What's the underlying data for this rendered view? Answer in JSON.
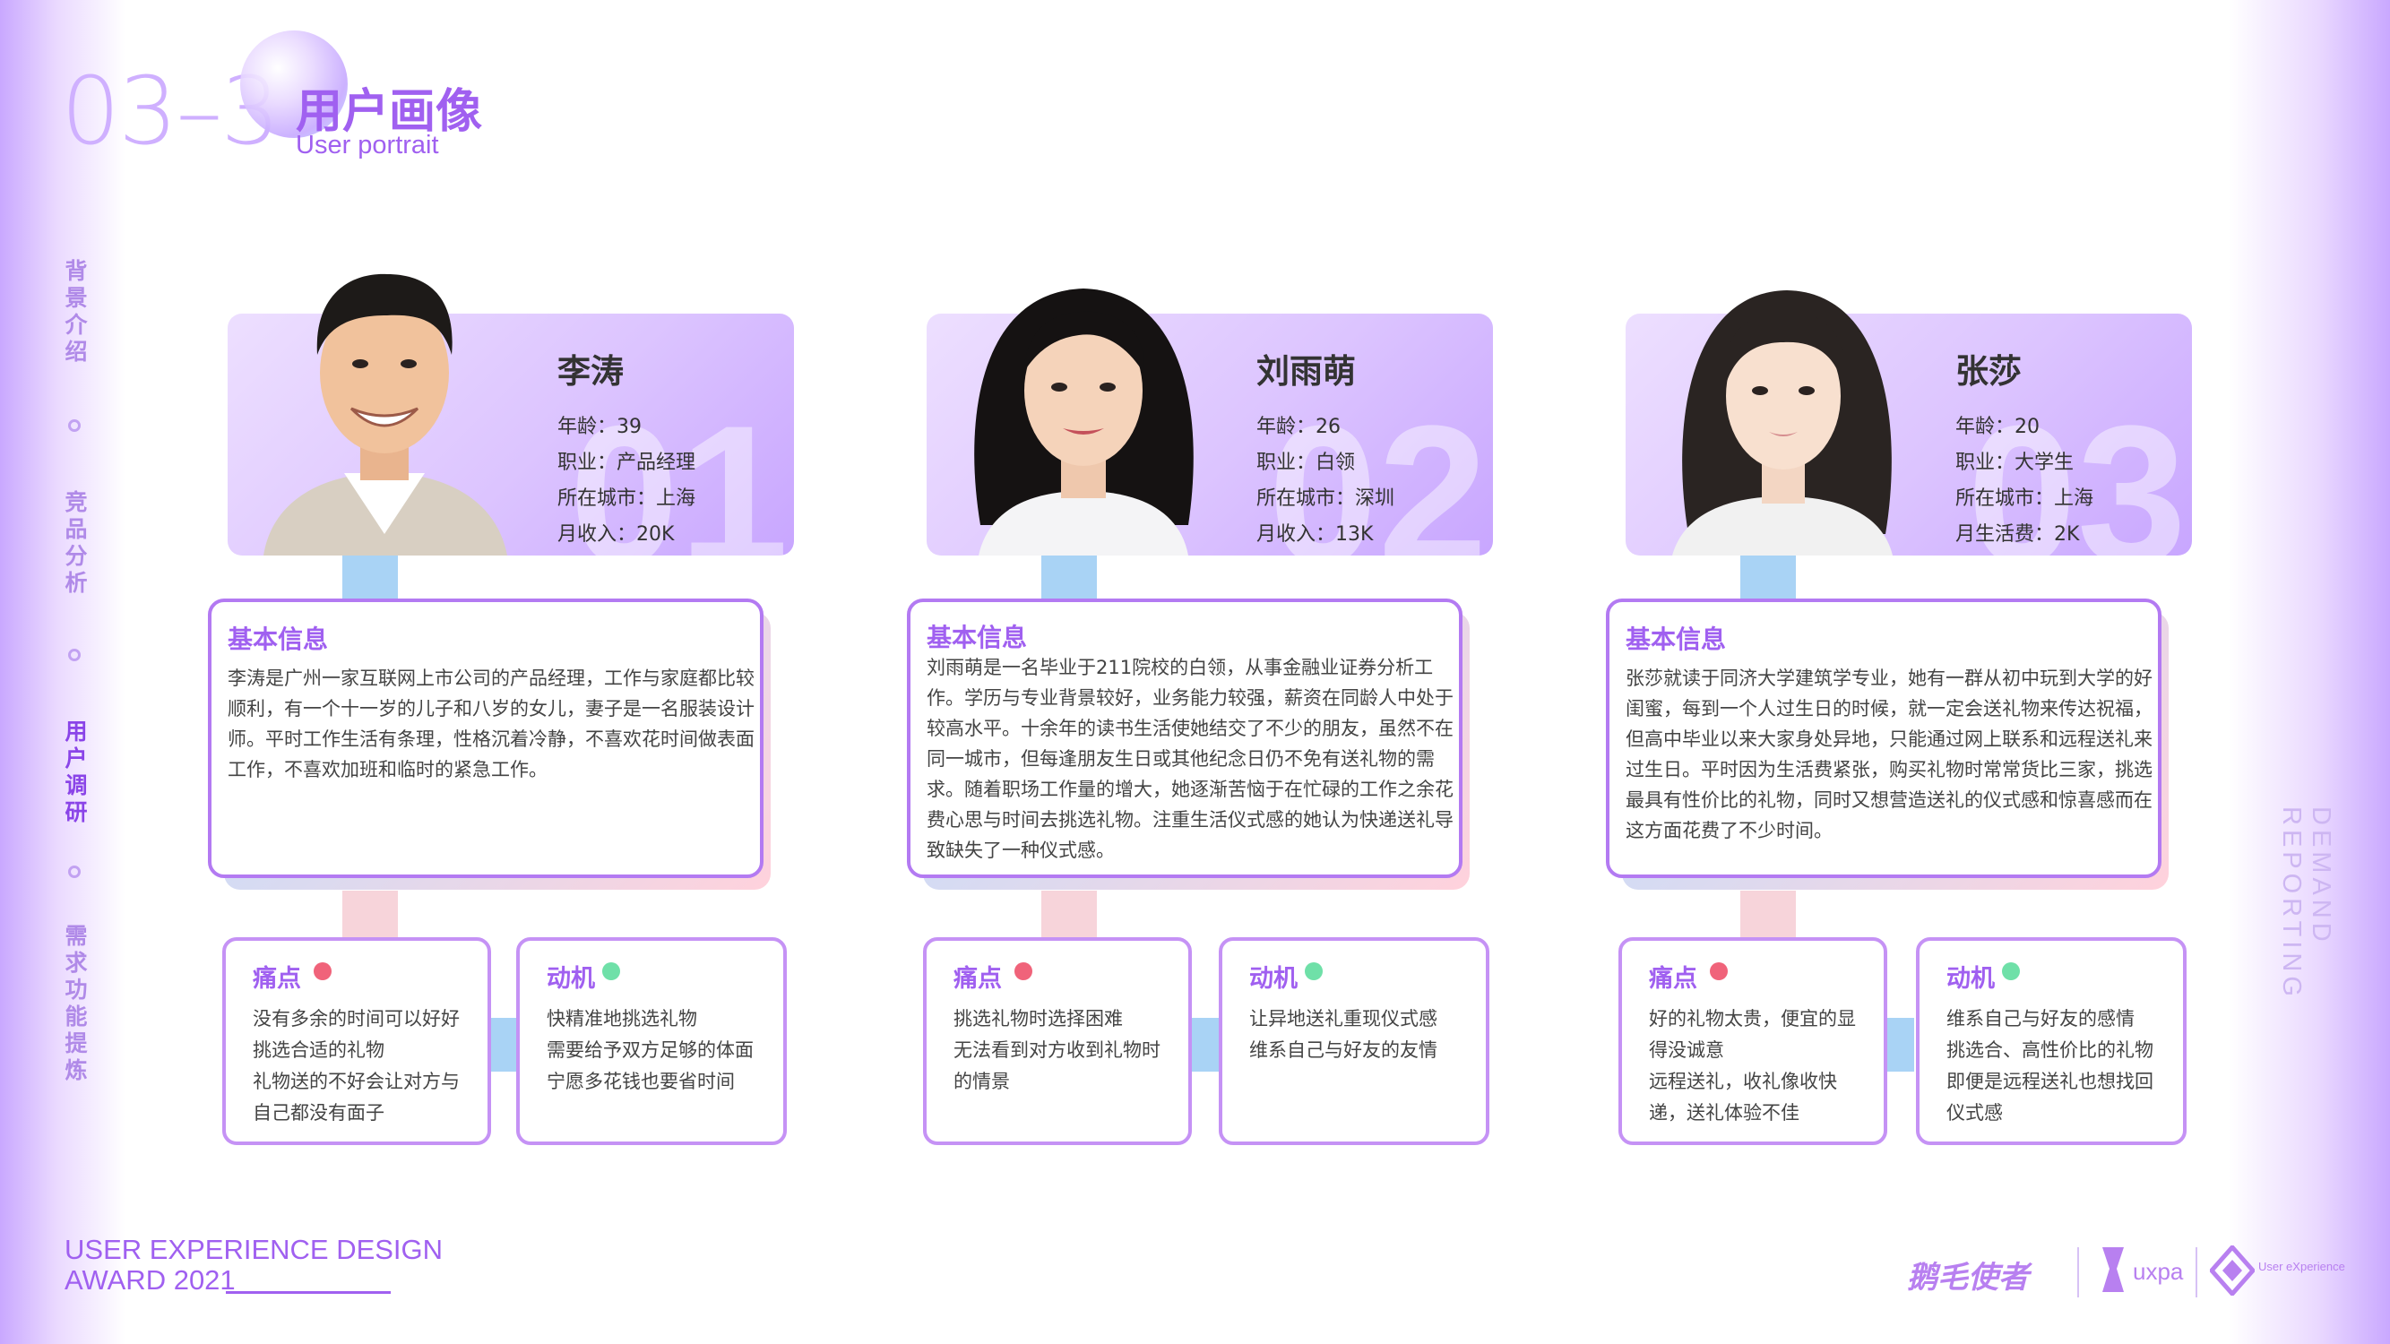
{
  "header": {
    "number": "03–3",
    "title": "用户画像",
    "subtitle": "User portrait"
  },
  "nav": [
    {
      "label": "背景介绍",
      "active": false
    },
    {
      "label": "竞品分析",
      "active": false
    },
    {
      "label": "用户调研",
      "active": true
    },
    {
      "label": "需求功能提炼",
      "active": false
    }
  ],
  "right_label": "DEMAND REPORTING",
  "personas": [
    {
      "index": "01",
      "name": "李涛",
      "lines": [
        "年龄：39",
        "职业：产品经理",
        "所在城市：上海",
        "月收入：20K"
      ],
      "info_title": "基本信息",
      "info_text": "李涛是广州一家互联网上市公司的产品经理，工作与家庭都比较顺利，有一个十一岁的儿子和八岁的女儿，妻子是一名服装设计师。平时工作生活有条理，性格沉着冷静，不喜欢花时间做表面工作，不喜欢加班和临时的紧急工作。",
      "pain_title": "痛点",
      "pain_text": "没有多余的时间可以好好挑选合适的礼物\n礼物送的不好会让对方与自己都没有面子",
      "motive_title": "动机",
      "motive_text": "快精准地挑选礼物\n需要给予双方足够的体面\n宁愿多花钱也要省时间"
    },
    {
      "index": "02",
      "name": "刘雨萌",
      "lines": [
        "年龄：26",
        "职业：白领",
        "所在城市：深圳",
        "月收入：13K"
      ],
      "info_title": "基本信息",
      "info_text": "刘雨萌是一名毕业于211院校的白领，从事金融业证券分析工作。学历与专业背景较好，业务能力较强，薪资在同龄人中处于较高水平。十余年的读书生活使她结交了不少的朋友，虽然不在同一城市，但每逢朋友生日或其他纪念日仍不免有送礼物的需求。随着职场工作量的增大，她逐渐苦恼于在忙碌的工作之余花费心思与时间去挑选礼物。注重生活仪式感的她认为快递送礼导致缺失了一种仪式感。",
      "pain_title": "痛点",
      "pain_text": "挑选礼物时选择困难\n无法看到对方收到礼物时的情景",
      "motive_title": "动机",
      "motive_text": "让异地送礼重现仪式感\n维系自己与好友的友情"
    },
    {
      "index": "03",
      "name": "张莎",
      "lines": [
        "年龄：20",
        "职业：大学生",
        "所在城市：上海",
        "月生活费：2K"
      ],
      "info_title": "基本信息",
      "info_text": "张莎就读于同济大学建筑学专业，她有一群从初中玩到大学的好闺蜜，每到一个人过生日的时候，就一定会送礼物来传达祝福，但高中毕业以来大家身处异地，只能通过网上联系和远程送礼来过生日。平时因为生活费紧张，购买礼物时常常货比三家，挑选最具有性价比的礼物，同时又想营造送礼的仪式感和惊喜感而在这方面花费了不少时间。",
      "pain_title": "痛点",
      "pain_text": "好的礼物太贵，便宜的显得没诚意\n远程送礼，收礼像收快递，送礼体验不佳",
      "motive_title": "动机",
      "motive_text": "维系自己与好友的感情\n挑选合、高性价比的礼物\n即便是远程送礼也想找回仪式感"
    }
  ],
  "footer": {
    "award_line1": "USER EXPERIENCE DESIGN",
    "award_line2": "AWARD 2021",
    "logo1": "鹅毛使者",
    "logo2": "uxpa",
    "logo3": "User eXperience"
  },
  "colors": {
    "accent": "#a060f0",
    "pain_dot": "#f0637a",
    "motive_dot": "#6fe0a8",
    "connector_blue": "#a9d3f5",
    "connector_pink": "#f7d4da"
  }
}
